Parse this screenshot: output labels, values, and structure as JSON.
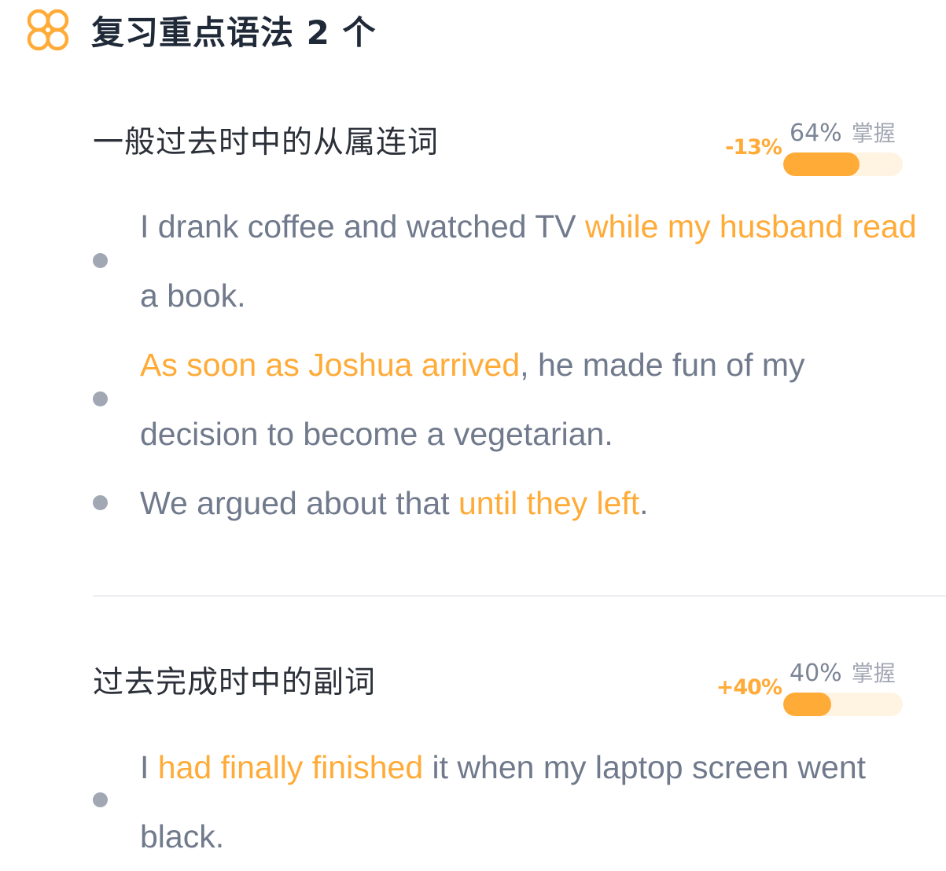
{
  "header": {
    "title": "复习重点语法 2 个",
    "icon": "flower-knot-icon",
    "accent": "#ffab38"
  },
  "sections": [
    {
      "title": "一般过去时中的从属连词",
      "delta": "-13%",
      "percent": "64%",
      "percent_label": "掌握",
      "mastery": 0.64,
      "items": [
        {
          "parts": [
            {
              "text": "I drank coffee and watched TV ",
              "highlight": false
            },
            {
              "text": "while my husband read",
              "highlight": true
            },
            {
              "text": " a book.",
              "highlight": false
            }
          ]
        },
        {
          "parts": [
            {
              "text": "As soon as Joshua arrived",
              "highlight": true
            },
            {
              "text": ", he made fun of my decision to become a vegetarian.",
              "highlight": false
            }
          ]
        },
        {
          "parts": [
            {
              "text": "We argued about that ",
              "highlight": false
            },
            {
              "text": "until they left",
              "highlight": true
            },
            {
              "text": ".",
              "highlight": false
            }
          ]
        }
      ]
    },
    {
      "title": "过去完成时中的副词",
      "delta": "+40%",
      "percent": "40%",
      "percent_label": "掌握",
      "mastery": 0.4,
      "items": [
        {
          "parts": [
            {
              "text": "I ",
              "highlight": false
            },
            {
              "text": "had finally finished",
              "highlight": true
            },
            {
              "text": " it when my laptop screen went black.",
              "highlight": false
            }
          ]
        }
      ]
    }
  ]
}
